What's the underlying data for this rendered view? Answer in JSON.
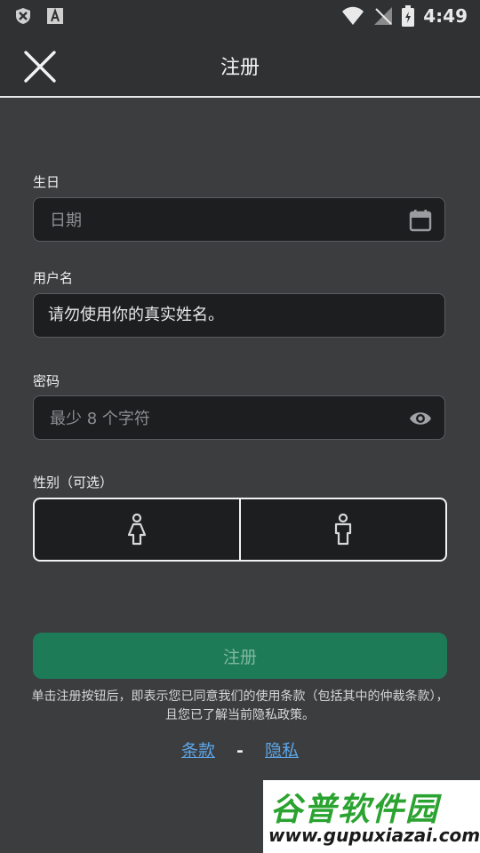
{
  "status_bar": {
    "time": "4:49",
    "icons": [
      "shield-icon",
      "a-icon",
      "wifi-icon",
      "signal-off-icon",
      "battery-icon"
    ]
  },
  "app_bar": {
    "title": "注册",
    "close_icon": "close-icon"
  },
  "form": {
    "birthday": {
      "label": "生日",
      "placeholder": "日期",
      "icon": "calendar-icon"
    },
    "username": {
      "label": "用户名",
      "value": "请勿使用你的真实姓名。"
    },
    "password": {
      "label": "密码",
      "placeholder": "最少 8 个字符",
      "icon": "eye-icon"
    },
    "gender": {
      "label": "性别（可选）",
      "options": [
        "female-icon",
        "male-icon"
      ]
    }
  },
  "register_button": {
    "label": "注册"
  },
  "disclaimer": "单击注册按钮后，即表示您已同意我们的使用条款（包括其中的仲裁条款），且您已了解当前隐私政策。",
  "links": {
    "terms": "条款",
    "separator": "-",
    "privacy": "隐私"
  },
  "watermark": {
    "top": "谷普软件园",
    "bottom": "www.gupuxiazai.com"
  },
  "colors": {
    "background": "#3b3d3f",
    "field_bg": "#1d1e20",
    "accent_green": "#1e7b58",
    "link_blue": "#5da5e8"
  }
}
